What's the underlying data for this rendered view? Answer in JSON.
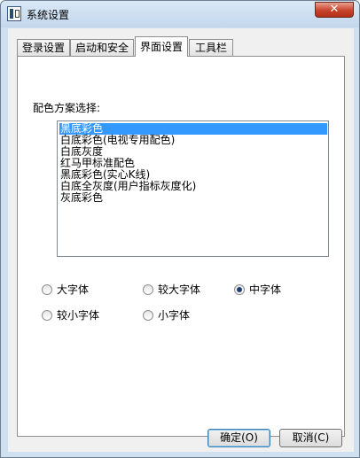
{
  "window": {
    "title": "系统设置",
    "close": "✕"
  },
  "tabs": [
    {
      "label": "登录设置"
    },
    {
      "label": "启动和安全"
    },
    {
      "label": "界面设置"
    },
    {
      "label": "工具栏"
    }
  ],
  "scheme": {
    "label": "配色方案选择:",
    "options": [
      {
        "label": "黑底彩色",
        "selected": true
      },
      {
        "label": "白底彩色(电视专用配色)",
        "selected": false
      },
      {
        "label": "白底灰度",
        "selected": false
      },
      {
        "label": "红马甲标准配色",
        "selected": false
      },
      {
        "label": "黑底彩色(实心K线)",
        "selected": false
      },
      {
        "label": "白底全灰度(用户指标灰度化)",
        "selected": false
      },
      {
        "label": "灰底彩色",
        "selected": false
      }
    ]
  },
  "font_size": {
    "options": [
      {
        "label": "大字体",
        "checked": false
      },
      {
        "label": "较大字体",
        "checked": false
      },
      {
        "label": "中字体",
        "checked": true
      },
      {
        "label": "较小字体",
        "checked": false
      },
      {
        "label": "小字体",
        "checked": false
      }
    ]
  },
  "buttons": {
    "ok": "确定(O)",
    "cancel": "取消(C)"
  }
}
